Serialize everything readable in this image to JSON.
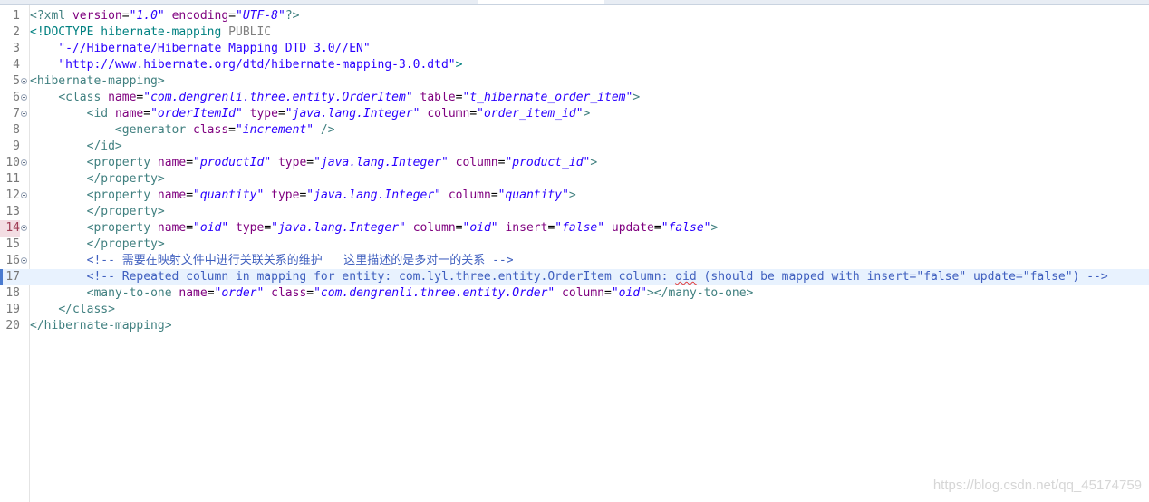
{
  "watermark": "https://blog.csdn.net/qq_45174759",
  "lines": [
    {
      "n": "1",
      "indent": "",
      "segs": [
        [
          "t",
          "<?xml "
        ],
        [
          "a",
          "version"
        ],
        [
          "p",
          "="
        ],
        [
          "v",
          "\"1.0\""
        ],
        [
          "p",
          " "
        ],
        [
          "a",
          "encoding"
        ],
        [
          "p",
          "="
        ],
        [
          "v",
          "\"UTF-8\""
        ],
        [
          "t",
          "?>"
        ]
      ]
    },
    {
      "n": "2",
      "indent": "",
      "segs": [
        [
          "dt",
          "<!DOCTYPE "
        ],
        [
          "dt",
          "hibernate-mapping "
        ],
        [
          "kw",
          "PUBLIC"
        ]
      ]
    },
    {
      "n": "3",
      "indent": "    ",
      "segs": [
        [
          "str",
          "\"-//Hibernate/Hibernate Mapping DTD 3.0//EN\""
        ]
      ]
    },
    {
      "n": "4",
      "indent": "    ",
      "segs": [
        [
          "str",
          "\"http://www.hibernate.org/dtd/hibernate-mapping-3.0.dtd\""
        ],
        [
          "dt",
          ">"
        ]
      ]
    },
    {
      "n": "5",
      "indent": "",
      "fold": true,
      "segs": [
        [
          "t",
          "<hibernate-mapping>"
        ]
      ]
    },
    {
      "n": "6",
      "indent": "    ",
      "fold": true,
      "segs": [
        [
          "t",
          "<class "
        ],
        [
          "a",
          "name"
        ],
        [
          "p",
          "="
        ],
        [
          "v",
          "\"com.dengrenli.three.entity.OrderItem\""
        ],
        [
          "p",
          " "
        ],
        [
          "a",
          "table"
        ],
        [
          "p",
          "="
        ],
        [
          "v",
          "\"t_hibernate_order_item\""
        ],
        [
          "t",
          ">"
        ]
      ]
    },
    {
      "n": "7",
      "indent": "        ",
      "fold": true,
      "segs": [
        [
          "t",
          "<id "
        ],
        [
          "a",
          "name"
        ],
        [
          "p",
          "="
        ],
        [
          "v",
          "\"orderItemId\""
        ],
        [
          "p",
          " "
        ],
        [
          "a",
          "type"
        ],
        [
          "p",
          "="
        ],
        [
          "v",
          "\"java.lang.Integer\""
        ],
        [
          "p",
          " "
        ],
        [
          "a",
          "column"
        ],
        [
          "p",
          "="
        ],
        [
          "v",
          "\"order_item_id\""
        ],
        [
          "t",
          ">"
        ]
      ]
    },
    {
      "n": "8",
      "indent": "            ",
      "segs": [
        [
          "t",
          "<generator "
        ],
        [
          "a",
          "class"
        ],
        [
          "p",
          "="
        ],
        [
          "v",
          "\"increment\""
        ],
        [
          "p",
          " "
        ],
        [
          "t",
          "/>"
        ]
      ]
    },
    {
      "n": "9",
      "indent": "        ",
      "segs": [
        [
          "t",
          "</id>"
        ]
      ]
    },
    {
      "n": "10",
      "indent": "        ",
      "fold": true,
      "segs": [
        [
          "t",
          "<property "
        ],
        [
          "a",
          "name"
        ],
        [
          "p",
          "="
        ],
        [
          "v",
          "\"productId\""
        ],
        [
          "p",
          " "
        ],
        [
          "a",
          "type"
        ],
        [
          "p",
          "="
        ],
        [
          "v",
          "\"java.lang.Integer\""
        ],
        [
          "p",
          " "
        ],
        [
          "a",
          "column"
        ],
        [
          "p",
          "="
        ],
        [
          "v",
          "\"product_id\""
        ],
        [
          "t",
          ">"
        ]
      ]
    },
    {
      "n": "11",
      "indent": "        ",
      "segs": [
        [
          "t",
          "</property>"
        ]
      ]
    },
    {
      "n": "12",
      "indent": "        ",
      "fold": true,
      "segs": [
        [
          "t",
          "<property "
        ],
        [
          "a",
          "name"
        ],
        [
          "p",
          "="
        ],
        [
          "v",
          "\"quantity\""
        ],
        [
          "p",
          " "
        ],
        [
          "a",
          "type"
        ],
        [
          "p",
          "="
        ],
        [
          "v",
          "\"java.lang.Integer\""
        ],
        [
          "p",
          " "
        ],
        [
          "a",
          "column"
        ],
        [
          "p",
          "="
        ],
        [
          "v",
          "\"quantity\""
        ],
        [
          "t",
          ">"
        ]
      ]
    },
    {
      "n": "13",
      "indent": "        ",
      "segs": [
        [
          "t",
          "</property>"
        ]
      ]
    },
    {
      "n": "14",
      "indent": "        ",
      "fold": true,
      "err": true,
      "segs": [
        [
          "t",
          "<property "
        ],
        [
          "a",
          "name"
        ],
        [
          "p",
          "="
        ],
        [
          "v",
          "\"oid\""
        ],
        [
          "p",
          " "
        ],
        [
          "a",
          "type"
        ],
        [
          "p",
          "="
        ],
        [
          "v",
          "\"java.lang.Integer\""
        ],
        [
          "p",
          " "
        ],
        [
          "a",
          "column"
        ],
        [
          "p",
          "="
        ],
        [
          "v",
          "\"oid\""
        ],
        [
          "p",
          " "
        ],
        [
          "a",
          "insert"
        ],
        [
          "p",
          "="
        ],
        [
          "v",
          "\"false\""
        ],
        [
          "p",
          " "
        ],
        [
          "a",
          "update"
        ],
        [
          "p",
          "="
        ],
        [
          "v",
          "\"false\""
        ],
        [
          "t",
          ">"
        ]
      ]
    },
    {
      "n": "15",
      "indent": "        ",
      "segs": [
        [
          "t",
          "</property>"
        ]
      ]
    },
    {
      "n": "16",
      "indent": "        ",
      "fold": true,
      "segs": [
        [
          "c",
          "<!-- 需要在映射文件中进行关联关系的维护   这里描述的是多对一的关系 -->"
        ]
      ]
    },
    {
      "n": "17",
      "indent": "        ",
      "current": true,
      "marker": true,
      "segs": [
        [
          "c",
          "<!-- Repeated column in mapping for entity: com.lyl.three.entity.OrderItem column: "
        ],
        [
          "cw",
          "oid"
        ],
        [
          "c",
          " (should be mapped with insert=\"false\" update=\"false\") -->"
        ]
      ]
    },
    {
      "n": "18",
      "indent": "        ",
      "segs": [
        [
          "t",
          "<many-to-one "
        ],
        [
          "a",
          "name"
        ],
        [
          "p",
          "="
        ],
        [
          "v",
          "\"order\""
        ],
        [
          "p",
          " "
        ],
        [
          "a",
          "class"
        ],
        [
          "p",
          "="
        ],
        [
          "v",
          "\"com.dengrenli.three.entity.Order\""
        ],
        [
          "p",
          " "
        ],
        [
          "a",
          "column"
        ],
        [
          "p",
          "="
        ],
        [
          "v",
          "\"oid\""
        ],
        [
          "t",
          "></many-to-one>"
        ]
      ]
    },
    {
      "n": "19",
      "indent": "    ",
      "segs": [
        [
          "t",
          "</class>"
        ]
      ]
    },
    {
      "n": "20",
      "indent": "",
      "segs": [
        [
          "t",
          "</hibernate-mapping>"
        ]
      ]
    }
  ]
}
